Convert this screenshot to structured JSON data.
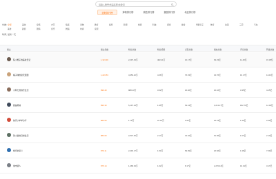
{
  "search": {
    "placeholder": "请输入账号/商品名称/关键词"
  },
  "tabs": [
    {
      "label": "涨粉排行榜",
      "active": true
    },
    {
      "label": "掉粉排行榜",
      "active": false
    },
    {
      "label": "销售排行榜",
      "active": false
    },
    {
      "label": "播放排行榜",
      "active": false
    },
    {
      "label": "地区排行榜",
      "active": false
    }
  ],
  "filters": {
    "category_label": "分类：",
    "row1": [
      "全部",
      "美妆",
      "穿搭",
      "才艺",
      "情感",
      "宠物",
      "教育",
      "搞笑",
      "影视",
      "旅游",
      "科技",
      "游戏",
      "健身",
      "母婴亲子",
      "体育",
      "动漫",
      "三农",
      "汽车",
      "职场",
      "生活",
      "其他"
    ],
    "row2": [
      "美食",
      "颜值",
      "剧情",
      "音乐",
      "舞蹈",
      "时尚",
      "家居"
    ],
    "time_label": "时间：",
    "time_value": "最新一天"
  },
  "table": {
    "headers": [
      "播主",
      "播主指数",
      "粉丝总数",
      "粉丝增量",
      "点赞总数",
      "播放总数",
      "评论总数",
      "转发总数"
    ],
    "rows": [
      {
        "name": "陈小橙子的美妆日记",
        "score": "1,324.30",
        "fans": "2,297.43万",
        "fans_inc": "482.41万",
        "likes": "10.17亿",
        "plays": "63.23亿",
        "comments": "11.40亿",
        "shares": "15.35亿",
        "avatar": "#6b5a4e"
      },
      {
        "name": "橘子味的夏天很甜",
        "score": "1,222.53",
        "fans": "4,956.42万",
        "fans_inc": "4.06万",
        "likes": "76.33亿",
        "plays": "32.76亿",
        "comments": "16.17亿",
        "shares": "11.02亿",
        "avatar": "#c9a27a"
      },
      {
        "name": "小阿七的快乐生活",
        "score": "996.40",
        "fans": "988.13万",
        "fans_inc": "3.02万",
        "likes": "16.40亿",
        "plays": "10.10亿",
        "comments": "3.35亿",
        "shares": "4.15亿",
        "avatar": "#8a6d5b"
      },
      {
        "name": "我是杨哥",
        "score": "896.30",
        "fans": "5,197.24万",
        "fans_inc": "1.95万",
        "likes": "54.43亿",
        "plays": "3,213.17亿",
        "comments": "182.71亿",
        "shares": "14.03亿",
        "avatar": "#3f4a5a"
      },
      {
        "name": "快乐小羊羊分享",
        "score": "885.50",
        "fans": "1.76万",
        "fans_inc": "24.44万",
        "likes": "0.92亿",
        "plays": "30.19亿",
        "comments": "1.43亿",
        "shares": "2.09亿",
        "avatar": "#d24c3a"
      },
      {
        "name": "张小晨的日常生活",
        "score": "880.60",
        "fans": "2,537.45万",
        "fans_inc": "2.17万",
        "likes": "13.32亿",
        "plays": "61.06亿",
        "comments": "1.07亿",
        "shares": "2.10亿",
        "avatar": "#5c6f63"
      },
      {
        "name": "旅行的意义",
        "score": "879.11",
        "fans": "2,493.17万",
        "fans_inc": "1.54万",
        "likes": "69.09亿",
        "plays": "20.66亿",
        "comments": "1.39亿",
        "shares": "7.09亿",
        "avatar": "#2f6fb0"
      },
      {
        "name": "城市猎人",
        "score": "875.14",
        "fans": "1,468.33万",
        "fans_inc": "1.02万",
        "likes": "8.17亿",
        "plays": "2,270.44亿",
        "comments": "19.31亿",
        "shares": "3.17亿",
        "avatar": "#7a7f86"
      }
    ]
  },
  "colors": {
    "accent": "#ff7a1a"
  }
}
